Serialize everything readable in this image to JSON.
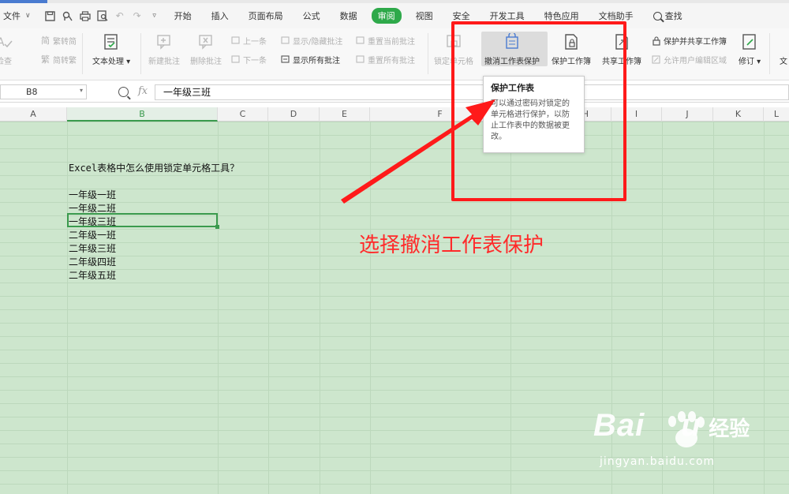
{
  "menubar": {
    "file_label": "文件",
    "tabs": [
      "开始",
      "插入",
      "页面布局",
      "公式",
      "数据",
      "审阅",
      "视图",
      "安全",
      "开发工具",
      "特色应用",
      "文档助手"
    ],
    "active_tab": "审阅",
    "search_label": "查找"
  },
  "ribbon": {
    "check_label": "检查",
    "trad_to_simp": "繁转简",
    "simp_to_trad": "简转繁",
    "text_process": "文本处理",
    "new_comment": "新建批注",
    "delete_comment": "删除批注",
    "prev_item": "上一条",
    "next_item": "下一条",
    "show_hide_comment": "显示/隐藏批注",
    "show_all_comments": "显示所有批注",
    "reset_current_comment": "重置当前批注",
    "reset_all_comments": "重置所有批注",
    "lock_cell": "锁定单元格",
    "unprotect_sheet": "撤消工作表保护",
    "protect_workbook": "保护工作簿",
    "share_workbook": "共享工作簿",
    "protect_share_workbook": "保护并共享工作簿",
    "allow_edit_ranges": "允许用户编辑区域",
    "revise": "修订",
    "doc_label": "文"
  },
  "formula_bar": {
    "name_box": "B8",
    "fx_label": "fx",
    "content": "一年级三班"
  },
  "columns": [
    "A",
    "B",
    "C",
    "D",
    "E",
    "F",
    "H",
    "I",
    "J",
    "K",
    "L"
  ],
  "selected_column": "B",
  "cells": {
    "title": "Excel表格中怎么使用锁定单元格工具？",
    "rows": [
      "一年级一班",
      "一年级二班",
      "一年级三班",
      "二年级一班",
      "二年级三班",
      "二年级四班",
      "二年级五班"
    ]
  },
  "tooltip": {
    "title": "保护工作表",
    "body": "可以通过密码对锁定的单元格进行保护，以防止工作表中的数据被更改。"
  },
  "annotation": {
    "text": "选择撤消工作表保护",
    "color": "#ff2a2a"
  },
  "watermark": {
    "brand": "Bai",
    "brand2": "u",
    "cn": "经验",
    "url": "jingyan.baidu.com"
  },
  "colors": {
    "accent_green": "#2ea94a",
    "sheet_bg": "#cde6cd",
    "highlight_red": "#ff1a1a"
  }
}
